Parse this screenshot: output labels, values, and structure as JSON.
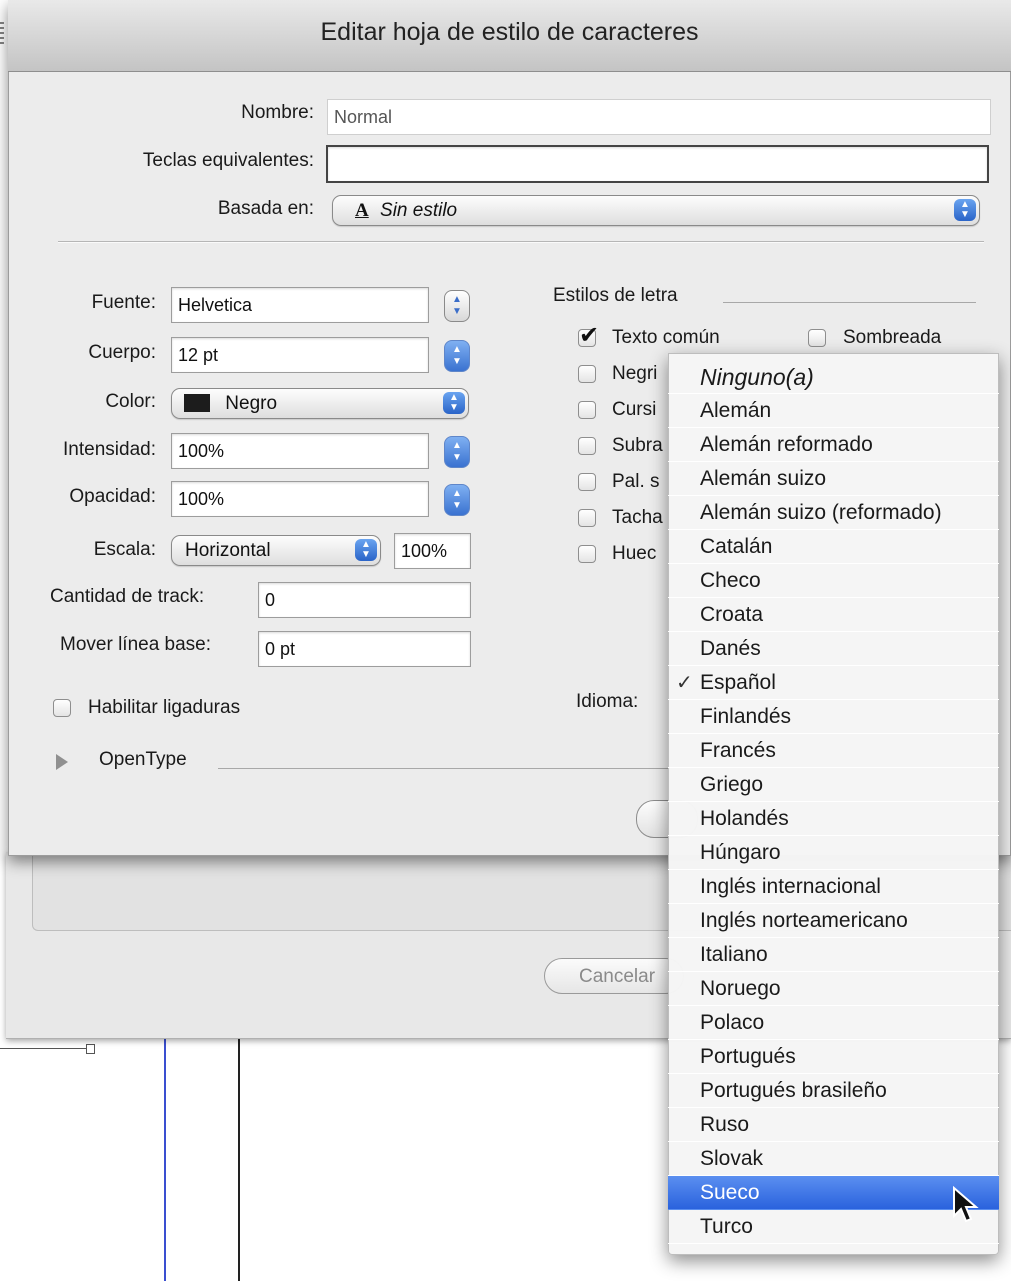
{
  "dialog": {
    "title": "Editar hoja de estilo de caracteres",
    "nombre_label": "Nombre:",
    "nombre_value": "Normal",
    "teclas_label": "Teclas equivalentes:",
    "teclas_value": "",
    "basada_label": "Basada en:",
    "basada_icon": "A",
    "basada_value": "Sin estilo",
    "fuente_label": "Fuente:",
    "fuente_value": "Helvetica",
    "cuerpo_label": "Cuerpo:",
    "cuerpo_value": "12 pt",
    "color_label": "Color:",
    "color_value": "Negro",
    "color_swatch": "#1c1c1c",
    "intensidad_label": "Intensidad:",
    "intensidad_value": "100%",
    "opacidad_label": "Opacidad:",
    "opacidad_value": "100%",
    "escala_label": "Escala:",
    "escala_value": "Horizontal",
    "escala_percent": "100%",
    "track_label": "Cantidad de track:",
    "track_value": "0",
    "linea_base_label": "Mover línea base:",
    "linea_base_value": "0 pt",
    "ligaduras_label": "Habilitar ligaduras",
    "opentype_label": "OpenType",
    "estilos_title": "Estilos de letra",
    "idioma_label": "Idioma:",
    "styles": [
      {
        "label": "Texto común",
        "checked": true
      },
      {
        "label": "Sombreada",
        "checked": false
      },
      {
        "label": "Negri",
        "checked": false
      },
      {
        "label": "Cursi",
        "checked": false
      },
      {
        "label": "Subra",
        "checked": false
      },
      {
        "label": "Pal. s",
        "checked": false
      },
      {
        "label": "Tacha",
        "checked": false
      },
      {
        "label": "Huec",
        "checked": false
      }
    ]
  },
  "outer_dialog": {
    "cancel_label": "Cancelar"
  },
  "language_menu": {
    "items": [
      "Ninguno(a)",
      "Alemán",
      "Alemán reformado",
      "Alemán suizo",
      "Alemán suizo (reformado)",
      "Catalán",
      "Checo",
      "Croata",
      "Danés",
      "Español",
      "Finlandés",
      "Francés",
      "Griego",
      "Holandés",
      "Húngaro",
      "Inglés internacional",
      "Inglés norteamericano",
      "Italiano",
      "Noruego",
      "Polaco",
      "Portugués",
      "Portugués brasileño",
      "Ruso",
      "Slovak",
      "Sueco",
      "Turco"
    ],
    "checked_item": "Español",
    "check_mark": "✓",
    "highlighted_item": "Sueco",
    "highlight_color": "#3d74e6"
  }
}
